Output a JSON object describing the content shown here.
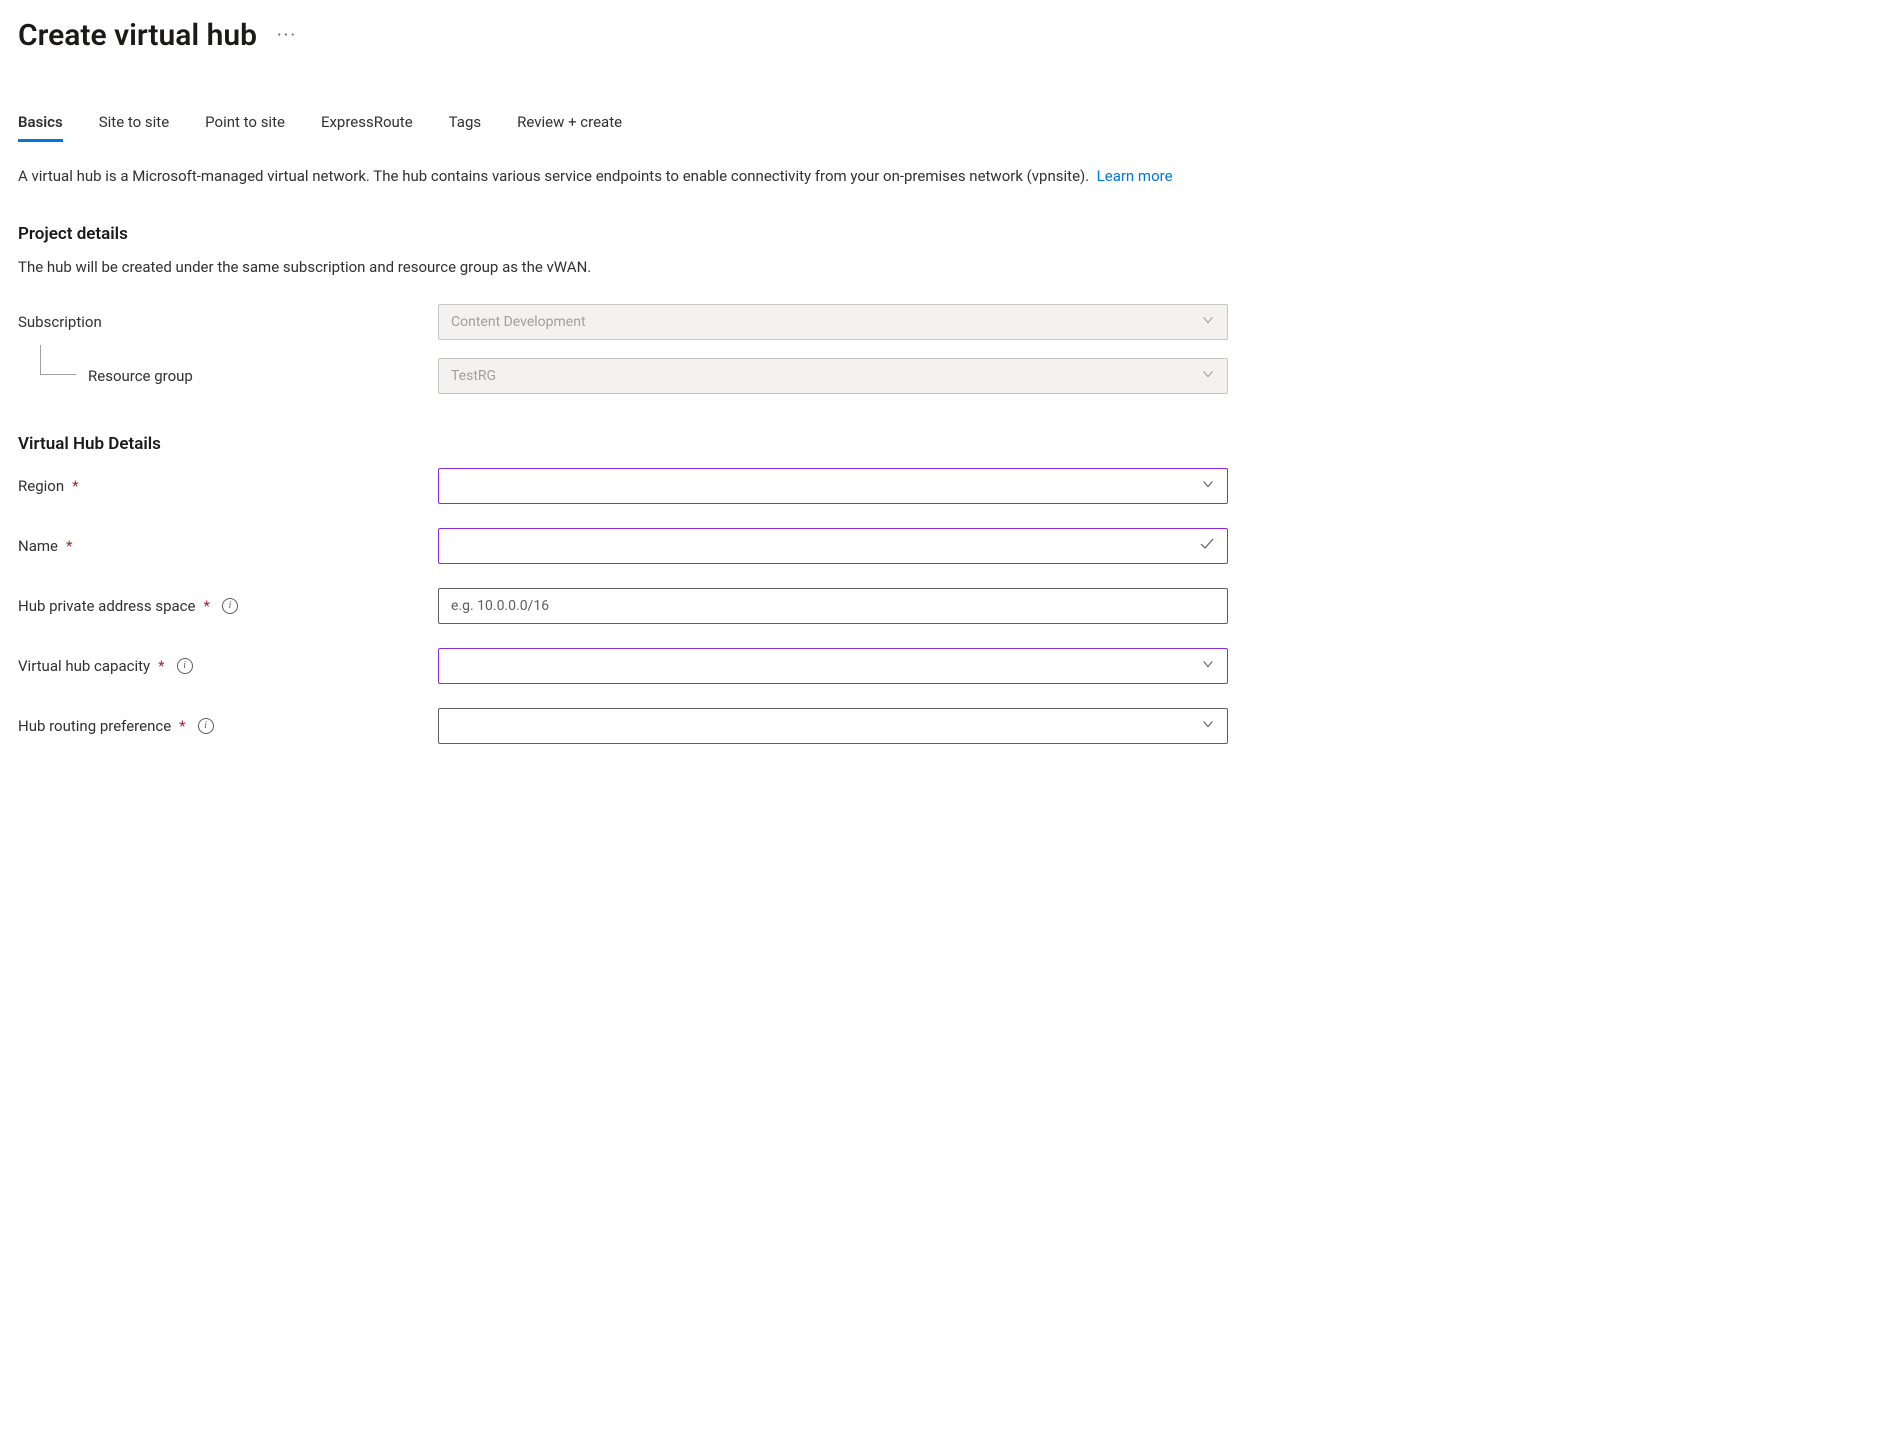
{
  "header": {
    "title": "Create virtual hub"
  },
  "tabs": {
    "items": [
      {
        "label": "Basics",
        "active": true
      },
      {
        "label": "Site to site",
        "active": false
      },
      {
        "label": "Point to site",
        "active": false
      },
      {
        "label": "ExpressRoute",
        "active": false
      },
      {
        "label": "Tags",
        "active": false
      },
      {
        "label": "Review + create",
        "active": false
      }
    ]
  },
  "description": {
    "text": "A virtual hub is a Microsoft-managed virtual network. The hub contains various service endpoints to enable connectivity from your on-premises network (vpnsite).",
    "link_label": "Learn more"
  },
  "sections": {
    "project": {
      "title": "Project details",
      "subtitle": "The hub will be created under the same subscription and resource group as the vWAN.",
      "fields": {
        "subscription": {
          "label": "Subscription",
          "value": "Content Development"
        },
        "resource_group": {
          "label": "Resource group",
          "value": "TestRG"
        }
      }
    },
    "hub": {
      "title": "Virtual Hub Details",
      "fields": {
        "region": {
          "label": "Region",
          "required": true,
          "value": ""
        },
        "name": {
          "label": "Name",
          "required": true,
          "value": ""
        },
        "address_space": {
          "label": "Hub private address space",
          "required": true,
          "info": true,
          "placeholder": "e.g. 10.0.0.0/16",
          "value": ""
        },
        "capacity": {
          "label": "Virtual hub capacity",
          "required": true,
          "info": true,
          "value": ""
        },
        "routing_pref": {
          "label": "Hub routing preference",
          "required": true,
          "info": true,
          "value": ""
        }
      }
    }
  }
}
